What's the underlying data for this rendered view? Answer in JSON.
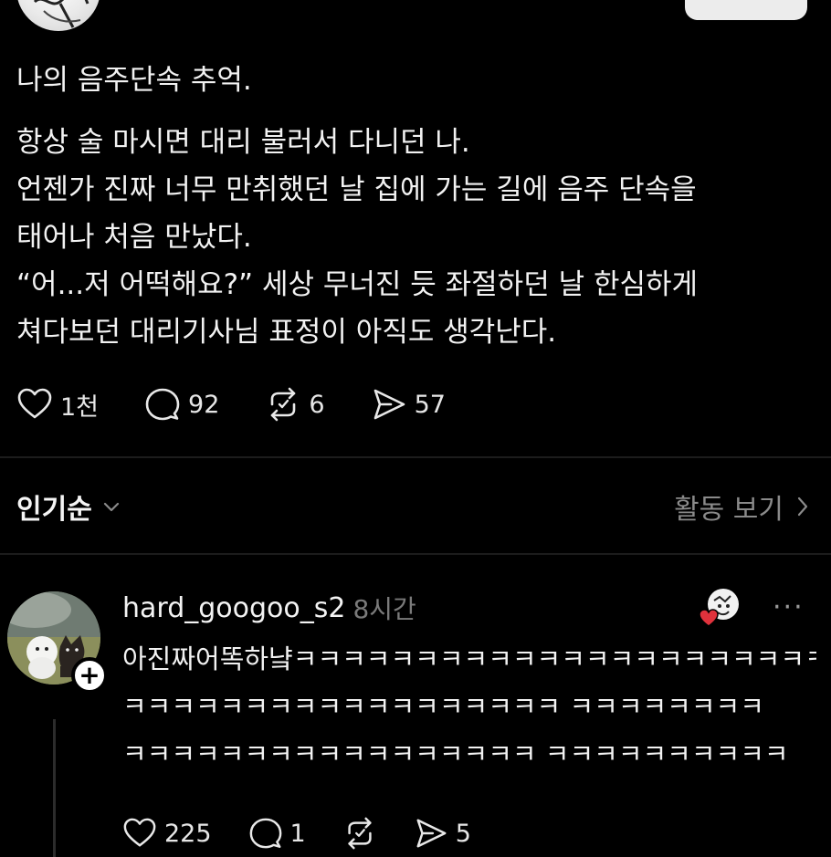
{
  "post": {
    "lead": "나의 음주단속 추억.",
    "lines": [
      "항상 술 마시면 대리 불러서 다니던 나.",
      "언젠가 진짜 너무 만취했던 날 집에 가는 길에 음주 단속을",
      "태어나 처음 만났다.",
      "“어...저 어떡해요?” 세상 무너진 듯 좌절하던 날 한심하게",
      "쳐다보던 대리기사님 표정이 아직도 생각난다."
    ],
    "stats": {
      "likes": "1천",
      "comments": "92",
      "reposts": "6",
      "shares": "57"
    }
  },
  "sort": {
    "label": "인기순",
    "activity_label": "활동 보기"
  },
  "comment": {
    "username": "hard_googoo_s2",
    "time": "8시간",
    "more_label": "···",
    "follow_label": "+",
    "lines": [
      "아진짜어똑하냨ㅋㅋㅋㅋㅋㅋㅋㅋㅋㅋㅋㅋㅋㅋㅋㅋㅋㅋㅋㅋㅋㅋ",
      "ㅋㅋㅋㅋㅋㅋㅋㅋㅋㅋㅋㅋㅋㅋㅋㅋㅋㅋ ㅋㅋㅋㅋㅋㅋㅋㅋ",
      "ㅋㅋㅋㅋㅋㅋㅋㅋㅋㅋㅋㅋㅋㅋㅋㅋㅋ ㅋㅋㅋㅋㅋㅋㅋㅋㅋㅋ"
    ],
    "stats": {
      "likes": "225",
      "comments": "1",
      "reposts": "",
      "shares": "5"
    }
  },
  "icons": {
    "like": "heart-icon",
    "comment": "comment-bubble-icon",
    "repost": "repost-icon",
    "share": "send-icon",
    "dropdown": "chevron-down-icon",
    "activity": "chevron-right-icon"
  },
  "colors": {
    "background": "#000000",
    "text": "#f2f2f2",
    "muted": "#7a7a7a",
    "liked_heart": "#e0323c"
  }
}
